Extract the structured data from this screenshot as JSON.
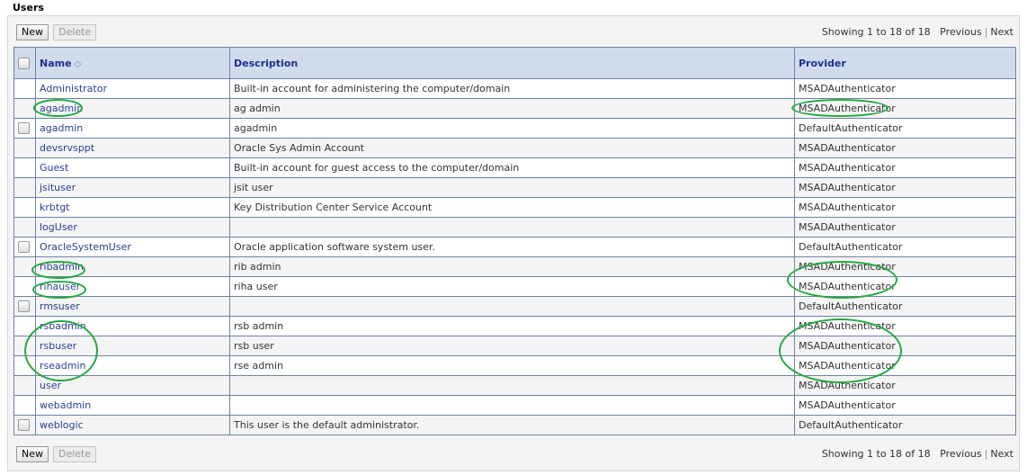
{
  "page": {
    "title": "Users"
  },
  "toolbar": {
    "new_label": "New",
    "delete_label": "Delete",
    "pager": {
      "status": "Showing 1 to 18 of 18",
      "previous": "Previous",
      "separator": "|",
      "next": "Next"
    }
  },
  "table": {
    "columns": [
      {
        "key": "name",
        "label": "Name",
        "sort": "ascending",
        "sort_icon": "sort-ascending-icon"
      },
      {
        "key": "description",
        "label": "Description"
      },
      {
        "key": "provider",
        "label": "Provider"
      }
    ],
    "rows": [
      {
        "name": "Administrator",
        "description": "Built-in account for administering the computer/domain",
        "provider": "MSADAuthenticator",
        "checkbox": false,
        "highlighted": false
      },
      {
        "name": "agadmin",
        "description": "ag admin",
        "provider": "MSADAuthenticator",
        "checkbox": false,
        "highlighted": true
      },
      {
        "name": "agadmin",
        "description": "agadmin",
        "provider": "DefaultAuthenticator",
        "checkbox": true,
        "highlighted": false
      },
      {
        "name": "devsrvsppt",
        "description": "Oracle Sys Admin Account",
        "provider": "MSADAuthenticator",
        "checkbox": false,
        "highlighted": false
      },
      {
        "name": "Guest",
        "description": "Built-in account for guest access to the computer/domain",
        "provider": "MSADAuthenticator",
        "checkbox": false,
        "highlighted": false
      },
      {
        "name": "jsituser",
        "description": "jsit user",
        "provider": "MSADAuthenticator",
        "checkbox": false,
        "highlighted": false
      },
      {
        "name": "krbtgt",
        "description": "Key Distribution Center Service Account",
        "provider": "MSADAuthenticator",
        "checkbox": false,
        "highlighted": false
      },
      {
        "name": "logUser",
        "description": "",
        "provider": "MSADAuthenticator",
        "checkbox": false,
        "highlighted": false
      },
      {
        "name": "OracleSystemUser",
        "description": "Oracle application software system user.",
        "provider": "DefaultAuthenticator",
        "checkbox": true,
        "highlighted": false
      },
      {
        "name": "ribadmin",
        "description": "rib admin",
        "provider": "MSADAuthenticator",
        "checkbox": false,
        "highlighted": true
      },
      {
        "name": "rihauser",
        "description": "riha user",
        "provider": "MSADAuthenticator",
        "checkbox": false,
        "highlighted": true
      },
      {
        "name": "rmsuser",
        "description": "",
        "provider": "DefaultAuthenticator",
        "checkbox": true,
        "highlighted": false
      },
      {
        "name": "rsbadmin",
        "description": "rsb admin",
        "provider": "MSADAuthenticator",
        "checkbox": false,
        "highlighted": true
      },
      {
        "name": "rsbuser",
        "description": "rsb user",
        "provider": "MSADAuthenticator",
        "checkbox": false,
        "highlighted": true
      },
      {
        "name": "rseadmin",
        "description": "rse admin",
        "provider": "MSADAuthenticator",
        "checkbox": false,
        "highlighted": true
      },
      {
        "name": "user",
        "description": "",
        "provider": "MSADAuthenticator",
        "checkbox": false,
        "highlighted": false
      },
      {
        "name": "webadmin",
        "description": "",
        "provider": "MSADAuthenticator",
        "checkbox": false,
        "highlighted": false
      },
      {
        "name": "weblogic",
        "description": "This user is the default administrator.",
        "provider": "DefaultAuthenticator",
        "checkbox": true,
        "highlighted": false
      }
    ]
  },
  "colors": {
    "header_bg": "#d0dbec",
    "header_text": "#1d2f8c",
    "link_text": "#2a3f93",
    "border": "#6b84a6",
    "stripe": "#f4f4f4",
    "annotation": "#26a844"
  }
}
